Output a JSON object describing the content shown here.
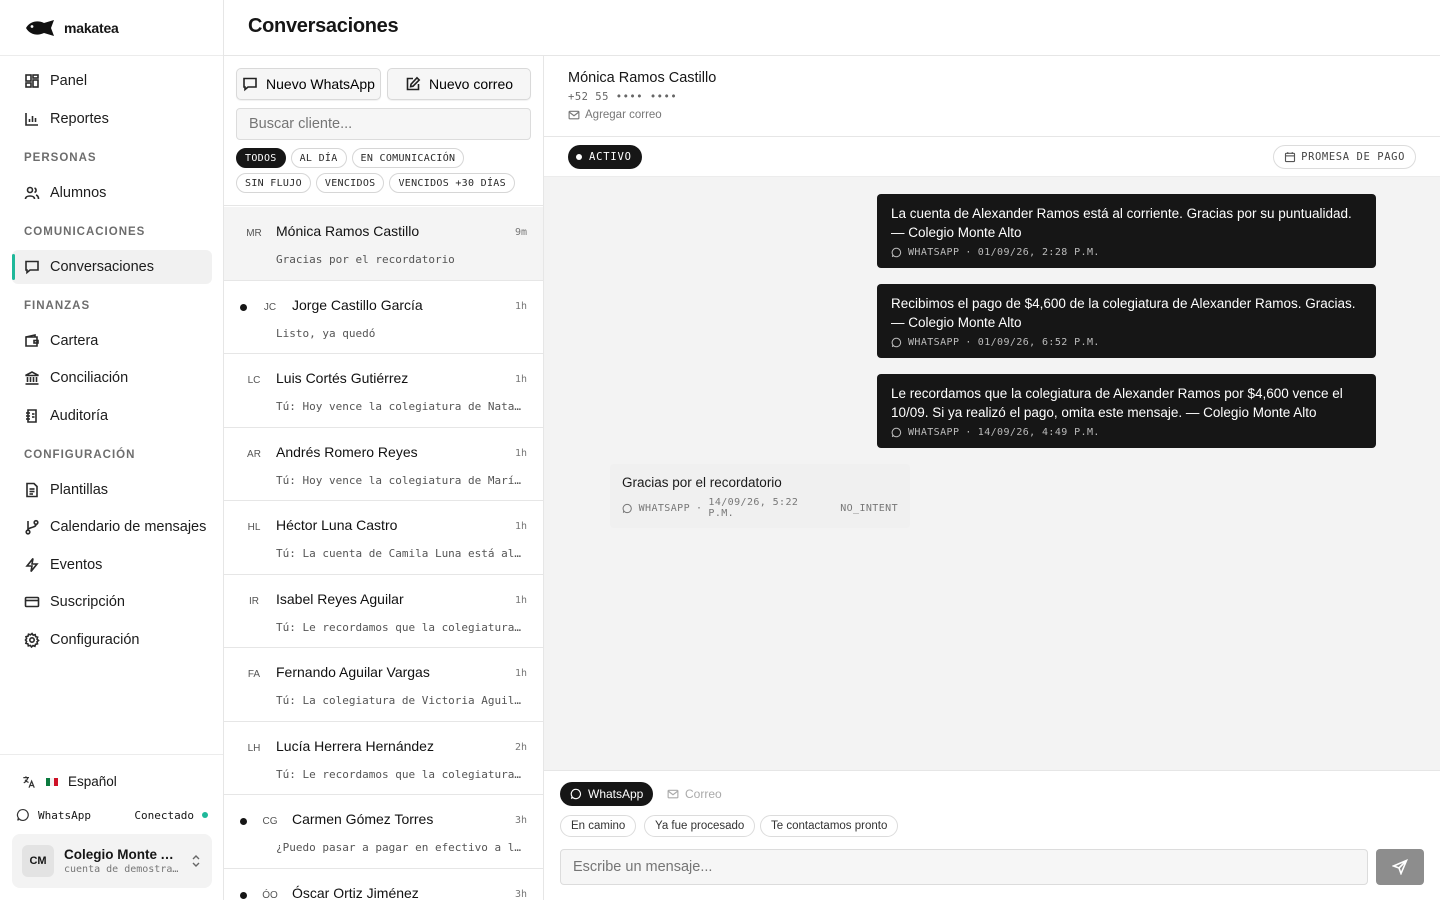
{
  "brand": {
    "name": "makatea"
  },
  "page_title": "Conversaciones",
  "sidebar": {
    "top_items": [
      {
        "label": "Panel",
        "icon": "dashboard-icon"
      },
      {
        "label": "Reportes",
        "icon": "bar-chart-icon"
      }
    ],
    "sections": [
      {
        "title": "PERSONAS",
        "items": [
          {
            "label": "Alumnos",
            "icon": "users-icon"
          }
        ]
      },
      {
        "title": "COMUNICACIONES",
        "items": [
          {
            "label": "Conversaciones",
            "icon": "chat-icon",
            "active": true
          }
        ]
      },
      {
        "title": "FINANZAS",
        "items": [
          {
            "label": "Cartera",
            "icon": "wallet-icon"
          },
          {
            "label": "Conciliación",
            "icon": "bank-icon"
          },
          {
            "label": "Auditoría",
            "icon": "audit-icon"
          }
        ]
      },
      {
        "title": "CONFIGURACIÓN",
        "items": [
          {
            "label": "Plantillas",
            "icon": "document-icon"
          },
          {
            "label": "Calendario de mensajes",
            "icon": "branch-icon"
          },
          {
            "label": "Eventos",
            "icon": "lightning-icon"
          },
          {
            "label": "Suscripción",
            "icon": "credit-card-icon"
          },
          {
            "label": "Configuración",
            "icon": "gear-icon"
          }
        ]
      }
    ],
    "language": "Español",
    "whatsapp_label": "WhatsApp",
    "whatsapp_status": "Conectado",
    "account": {
      "initials": "CM",
      "name": "Colegio Monte Alto",
      "subtitle": "cuenta de demostración"
    }
  },
  "list": {
    "new_whatsapp": "Nuevo WhatsApp",
    "new_email": "Nuevo correo",
    "search_placeholder": "Buscar cliente...",
    "filters": [
      {
        "label": "TODOS",
        "active": true
      },
      {
        "label": "AL DÍA"
      },
      {
        "label": "EN COMUNICACIÓN"
      },
      {
        "label": "SIN FLUJO"
      },
      {
        "label": "VENCIDOS"
      },
      {
        "label": "VENCIDOS +30 DÍAS"
      }
    ],
    "conversations": [
      {
        "initials": "MR",
        "name": "Mónica Ramos Castillo",
        "time": "9m",
        "preview": "Gracias por el recordatorio",
        "unread": false,
        "selected": true
      },
      {
        "initials": "JC",
        "name": "Jorge Castillo García",
        "time": "1h",
        "preview": "Listo, ya quedó",
        "unread": true
      },
      {
        "initials": "LC",
        "name": "Luis Cortés Gutiérrez",
        "time": "1h",
        "preview": "Tú: Hoy vence la colegiatura de Natalia Cortés",
        "unread": false
      },
      {
        "initials": "AR",
        "name": "Andrés Romero Reyes",
        "time": "1h",
        "preview": "Tú: Hoy vence la colegiatura de María Romero",
        "unread": false
      },
      {
        "initials": "HL",
        "name": "Héctor Luna Castro",
        "time": "1h",
        "preview": "Tú: La cuenta de Camila Luna está al corriente",
        "unread": false
      },
      {
        "initials": "IR",
        "name": "Isabel Reyes Aguilar",
        "time": "1h",
        "preview": "Tú: Le recordamos que la colegiatura de",
        "unread": false
      },
      {
        "initials": "FA",
        "name": "Fernando Aguilar Vargas",
        "time": "1h",
        "preview": "Tú: La colegiatura de Victoria Aguilar",
        "unread": false
      },
      {
        "initials": "LH",
        "name": "Lucía Herrera Hernández",
        "time": "2h",
        "preview": "Tú: Le recordamos que la colegiatura de",
        "unread": false
      },
      {
        "initials": "CG",
        "name": "Carmen Gómez Torres",
        "time": "3h",
        "preview": "¿Puedo pasar a pagar en efectivo a la escuela?",
        "unread": true
      },
      {
        "initials": "ÓO",
        "name": "Óscar Ortiz Jiménez",
        "time": "3h",
        "preview": "",
        "unread": true
      }
    ]
  },
  "chat": {
    "contact_name": "Mónica Ramos Castillo",
    "phone": "+52 55 •••• ••••",
    "add_email": "Agregar correo",
    "status_badge": "ACTIVO",
    "promise_button": "PROMESA DE PAGO",
    "messages": [
      {
        "direction": "out",
        "text": "La cuenta de Alexander Ramos está al corriente. Gracias por su puntualidad. — Colegio Monte Alto",
        "channel": "WHATSAPP",
        "timestamp": "01/09/26, 2:28 P.M."
      },
      {
        "direction": "out",
        "text": "Recibimos el pago de $4,600 de la colegiatura de Alexander Ramos. Gracias. — Colegio Monte Alto",
        "channel": "WHATSAPP",
        "timestamp": "01/09/26, 6:52 P.M."
      },
      {
        "direction": "out",
        "text": "Le recordamos que la colegiatura de Alexander Ramos por $4,600 vence el 10/09. Si ya realizó el pago, omita este mensaje. — Colegio Monte Alto",
        "channel": "WHATSAPP",
        "timestamp": "14/09/26, 4:49 P.M."
      },
      {
        "direction": "in",
        "text": "Gracias por el recordatorio",
        "channel": "WHATSAPP",
        "timestamp": "14/09/26, 5:22 P.M.",
        "intent": "NO_INTENT"
      }
    ],
    "composer": {
      "tab_whatsapp": "WhatsApp",
      "tab_email": "Correo",
      "quick_replies": [
        "En camino",
        "Ya fue procesado",
        "Te contactamos pronto"
      ],
      "placeholder": "Escribe un mensaje..."
    }
  },
  "colors": {
    "accent": "#1fb89a",
    "dark": "#161616",
    "chat_bg": "#f3f3f3"
  }
}
